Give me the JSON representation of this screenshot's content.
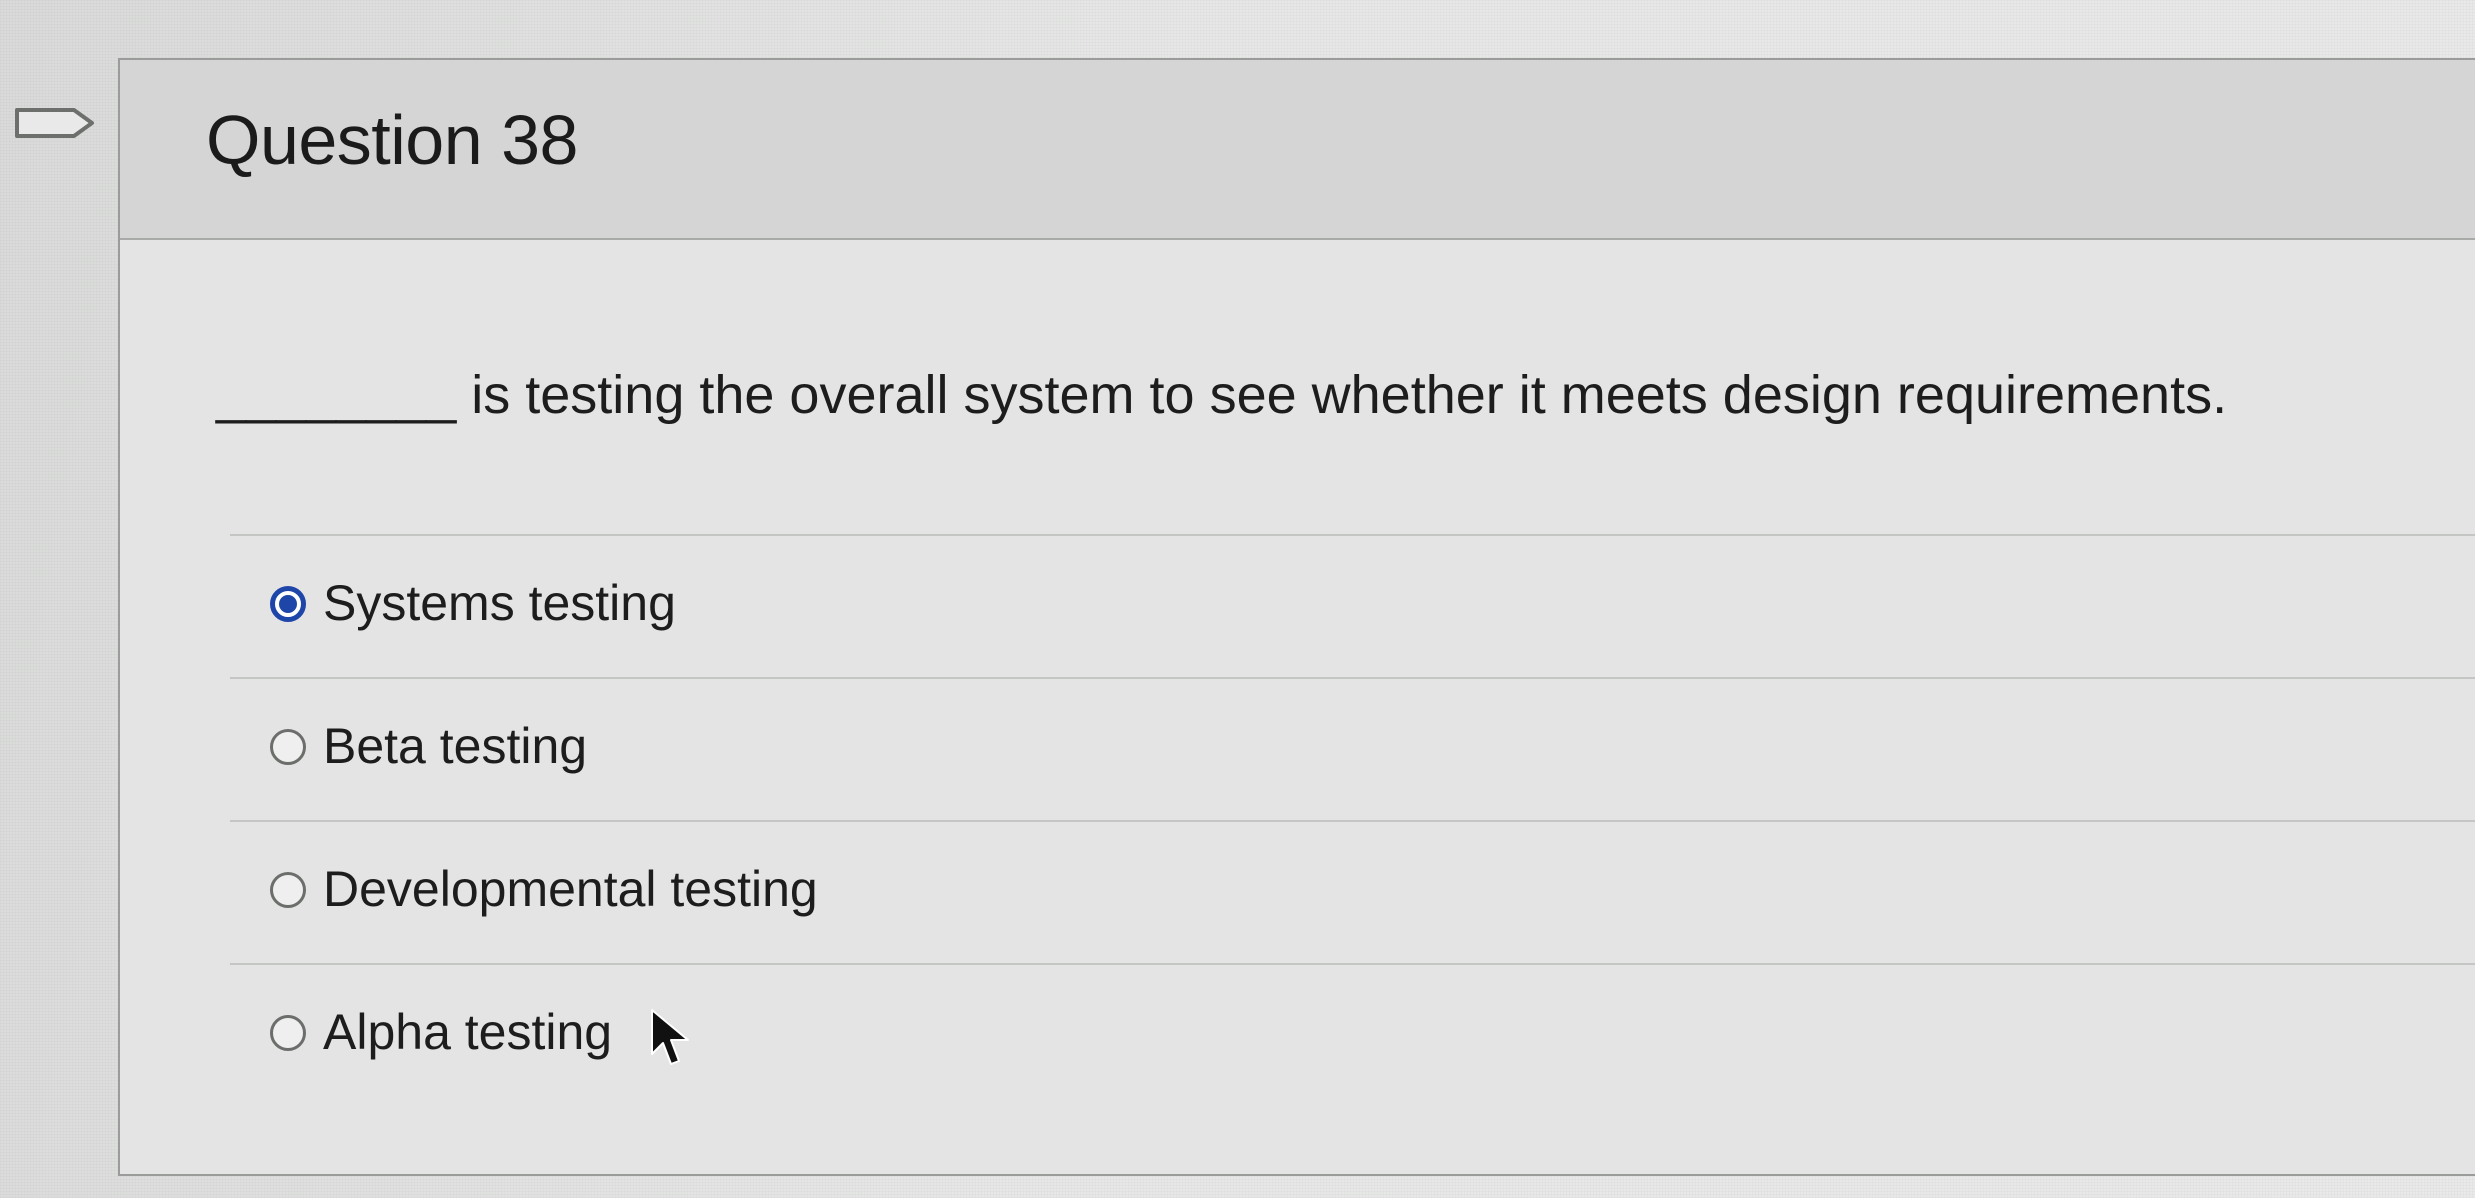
{
  "question": {
    "title": "Question 38",
    "prompt": "________ is testing the overall system to see whether it meets design requirements.",
    "answers": [
      {
        "label": "Systems testing",
        "selected": true
      },
      {
        "label": "Beta testing",
        "selected": false
      },
      {
        "label": "Developmental testing",
        "selected": false
      },
      {
        "label": "Alpha testing",
        "selected": false
      }
    ]
  },
  "icons": {
    "flag": "flag-outline-icon",
    "cursor": "mouse-pointer-icon"
  },
  "colors": {
    "selected_radio": "#1d46a8"
  }
}
